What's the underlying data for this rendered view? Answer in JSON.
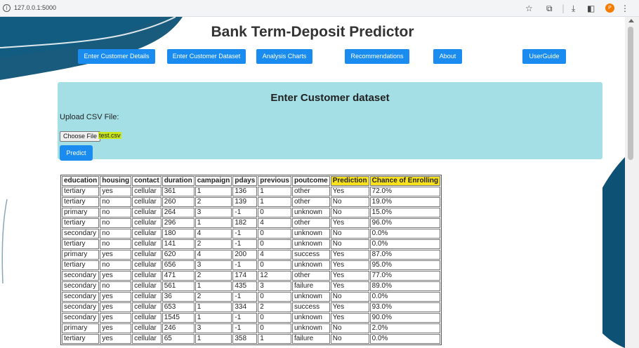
{
  "browser": {
    "url": "127.0.0.1:5000",
    "profile_initial": "P"
  },
  "page": {
    "title": "Bank Term-Deposit Predictor",
    "nav": [
      "Enter Customer Details",
      "Enter Customer Dataset",
      "Analysis Charts",
      "Recommendations",
      "About",
      "UserGuide"
    ]
  },
  "panel": {
    "heading": "Enter Customer dataset",
    "upload_label": "Upload CSV File:",
    "choose_file": "Choose File",
    "file_name": "test.csv",
    "predict": "Predict"
  },
  "table": {
    "columns": [
      "education",
      "housing",
      "contact",
      "duration",
      "campaign",
      "pdays",
      "previous",
      "poutcome",
      "Prediction",
      "Chance of Enrolling"
    ],
    "rows": [
      [
        "tertiary",
        "yes",
        "cellular",
        "361",
        "1",
        "136",
        "1",
        "other",
        "Yes",
        "72.0%"
      ],
      [
        "tertiary",
        "no",
        "cellular",
        "260",
        "2",
        "139",
        "1",
        "other",
        "No",
        "19.0%"
      ],
      [
        "primary",
        "no",
        "cellular",
        "264",
        "3",
        "-1",
        "0",
        "unknown",
        "No",
        "15.0%"
      ],
      [
        "tertiary",
        "no",
        "cellular",
        "296",
        "1",
        "182",
        "4",
        "other",
        "Yes",
        "96.0%"
      ],
      [
        "secondary",
        "no",
        "cellular",
        "180",
        "4",
        "-1",
        "0",
        "unknown",
        "No",
        "0.0%"
      ],
      [
        "tertiary",
        "no",
        "cellular",
        "141",
        "2",
        "-1",
        "0",
        "unknown",
        "No",
        "0.0%"
      ],
      [
        "primary",
        "yes",
        "cellular",
        "620",
        "4",
        "200",
        "4",
        "success",
        "Yes",
        "87.0%"
      ],
      [
        "tertiary",
        "no",
        "cellular",
        "656",
        "3",
        "-1",
        "0",
        "unknown",
        "Yes",
        "95.0%"
      ],
      [
        "secondary",
        "yes",
        "cellular",
        "471",
        "2",
        "174",
        "12",
        "other",
        "Yes",
        "77.0%"
      ],
      [
        "secondary",
        "no",
        "cellular",
        "561",
        "1",
        "435",
        "3",
        "failure",
        "Yes",
        "89.0%"
      ],
      [
        "secondary",
        "yes",
        "cellular",
        "36",
        "2",
        "-1",
        "0",
        "unknown",
        "No",
        "0.0%"
      ],
      [
        "secondary",
        "yes",
        "cellular",
        "653",
        "1",
        "334",
        "2",
        "success",
        "Yes",
        "93.0%"
      ],
      [
        "secondary",
        "yes",
        "cellular",
        "1545",
        "1",
        "-1",
        "0",
        "unknown",
        "Yes",
        "90.0%"
      ],
      [
        "primary",
        "yes",
        "cellular",
        "246",
        "3",
        "-1",
        "0",
        "unknown",
        "No",
        "2.0%"
      ],
      [
        "tertiary",
        "yes",
        "cellular",
        "65",
        "1",
        "358",
        "1",
        "failure",
        "No",
        "0.0%"
      ]
    ]
  },
  "colors": {
    "accent": "#1a8cf0",
    "panel_bg": "#a4dfe6",
    "wave_dark": "#0d5275",
    "highlight": "#f9e11c"
  }
}
